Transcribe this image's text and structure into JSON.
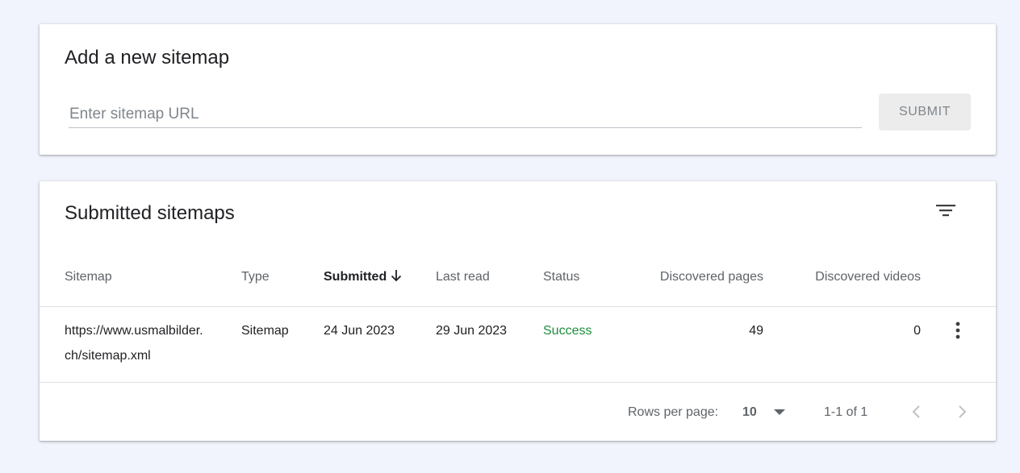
{
  "add_sitemap": {
    "title": "Add a new sitemap",
    "url_placeholder": "Enter sitemap URL",
    "url_value": "",
    "submit_label": "SUBMIT"
  },
  "submitted": {
    "title": "Submitted sitemaps",
    "filter_icon": "filter-list-icon",
    "columns": {
      "sitemap": "Sitemap",
      "type": "Type",
      "submitted": "Submitted",
      "last_read": "Last read",
      "status": "Status",
      "discovered_pages": "Discovered pages",
      "discovered_videos": "Discovered videos"
    },
    "sort_icon": "arrow-down-icon",
    "rows": [
      {
        "sitemap_line1": "https://www.usmalbilder.",
        "sitemap_line2": "ch/sitemap.xml",
        "type": "Sitemap",
        "submitted": "24 Jun 2023",
        "last_read": "29 Jun 2023",
        "status": "Success",
        "discovered_pages": "49",
        "discovered_videos": "0",
        "menu_icon": "more-vert-icon"
      }
    ],
    "pagination": {
      "rows_per_page_label": "Rows per page:",
      "rows_per_page_value": "10",
      "range": "1-1 of 1",
      "prev_icon": "chevron-left-icon",
      "next_icon": "chevron-right-icon"
    }
  },
  "colors": {
    "page_background": "#f1f4fc",
    "success": "#1e8e3e",
    "muted_text": "#5f6368"
  }
}
